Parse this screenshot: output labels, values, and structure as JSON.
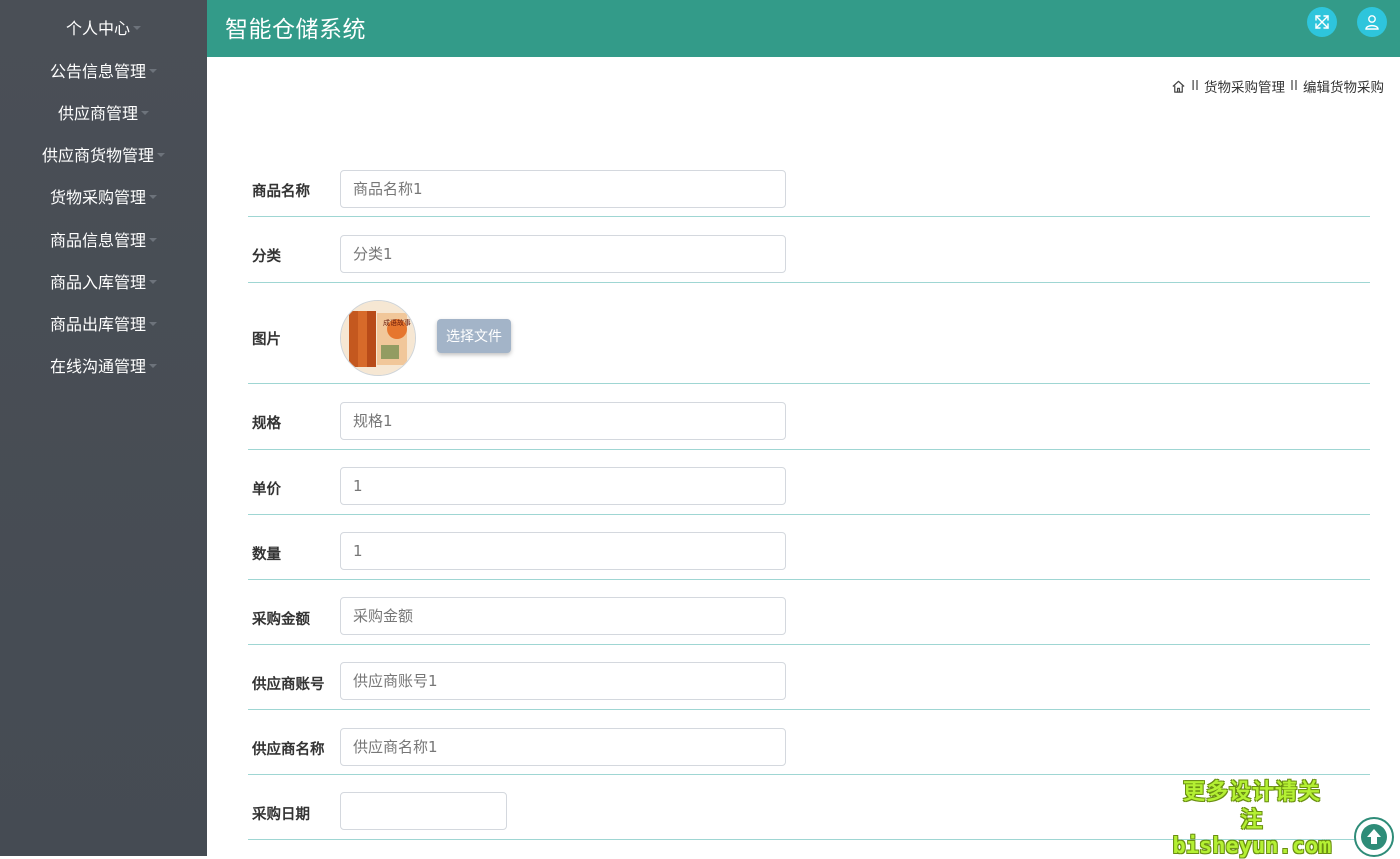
{
  "app": {
    "title": "智能仓储系统"
  },
  "sidebar": {
    "items": [
      {
        "label": "个人中心"
      },
      {
        "label": "公告信息管理"
      },
      {
        "label": "供应商管理"
      },
      {
        "label": "供应商货物管理"
      },
      {
        "label": "货物采购管理"
      },
      {
        "label": "商品信息管理"
      },
      {
        "label": "商品入库管理"
      },
      {
        "label": "商品出库管理"
      },
      {
        "label": "在线沟通管理"
      }
    ]
  },
  "header": {
    "icons": {
      "fullscreen": "expand-arrows-icon",
      "user": "user-icon"
    },
    "accent_color": "#339b89",
    "button_color": "#2ec5dc"
  },
  "breadcrumb": {
    "separator": "II",
    "items": [
      "货物采购管理",
      "编辑货物采购"
    ]
  },
  "form": {
    "product_name": {
      "label": "商品名称",
      "value": "",
      "placeholder": "商品名称1"
    },
    "category": {
      "label": "分类",
      "value": "",
      "placeholder": "分类1"
    },
    "image": {
      "label": "图片",
      "thumb_text": "成语故事",
      "file_button": "选择文件"
    },
    "spec": {
      "label": "规格",
      "value": "",
      "placeholder": "规格1"
    },
    "unit_price": {
      "label": "单价",
      "value": "",
      "placeholder": "1"
    },
    "quantity": {
      "label": "数量",
      "value": "",
      "placeholder": "1"
    },
    "amount": {
      "label": "采购金额",
      "value": "",
      "placeholder": "采购金额"
    },
    "supplier_account": {
      "label": "供应商账号",
      "value": "",
      "placeholder": "供应商账号1"
    },
    "supplier_name": {
      "label": "供应商名称",
      "value": "",
      "placeholder": "供应商名称1"
    },
    "purchase_date": {
      "label": "采购日期",
      "value": "",
      "placeholder": ""
    }
  },
  "watermark": {
    "line1": "更多设计请关注",
    "line2": "bisheyun.com"
  }
}
